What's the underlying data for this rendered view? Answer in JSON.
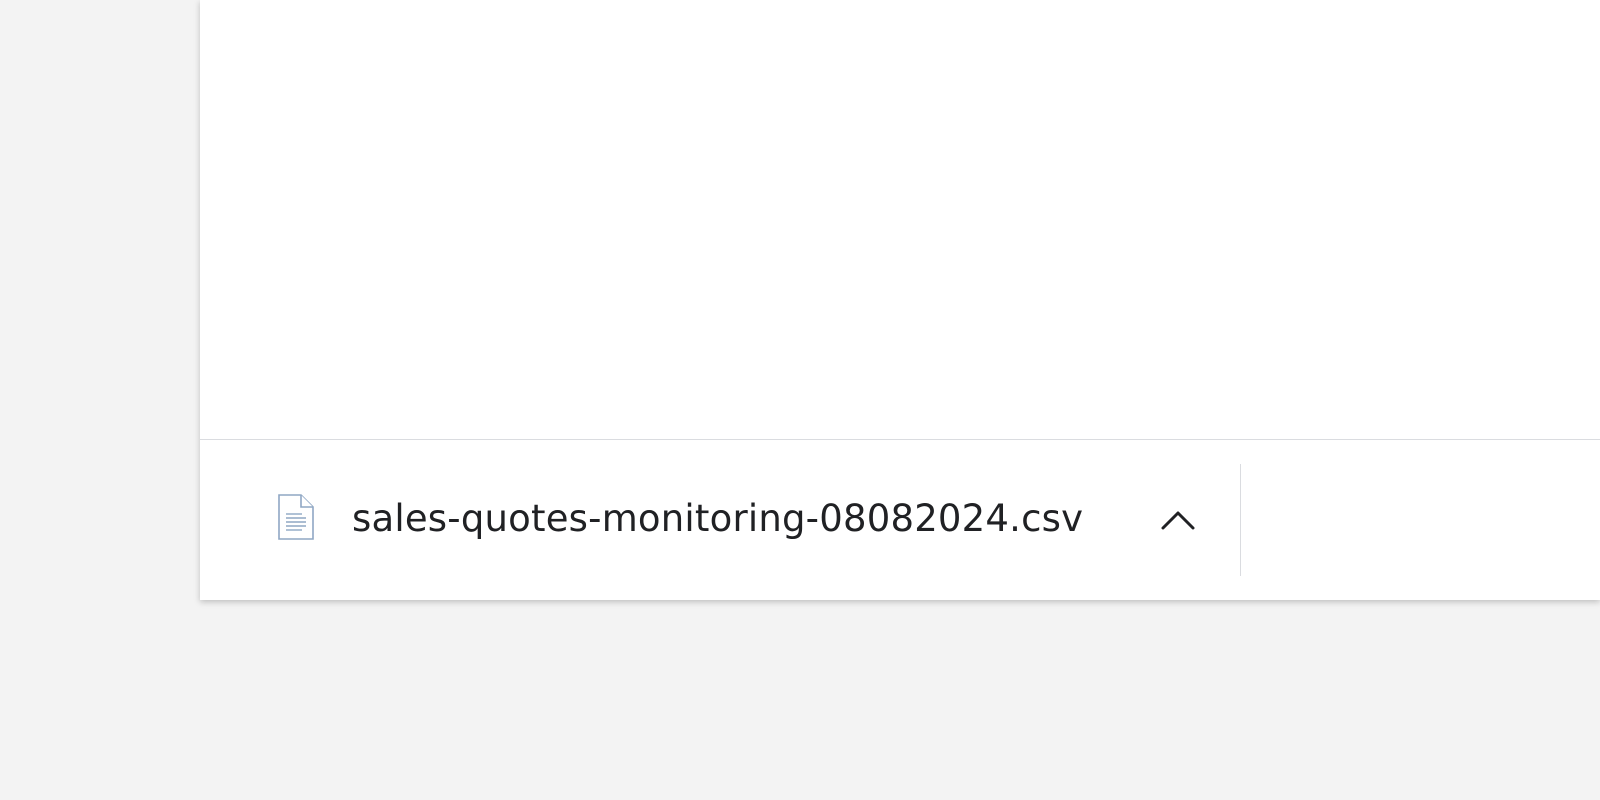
{
  "download_shelf": {
    "items": [
      {
        "file_name": "sales-quotes-monitoring-08082024.csv",
        "icon": "document-file-icon",
        "menu_icon": "chevron-up-icon"
      }
    ]
  },
  "colors": {
    "background": "#f3f3f3",
    "window": "#ffffff",
    "divider": "#dadce0",
    "text": "#202124",
    "icon_stroke": "#8fa7c4"
  }
}
